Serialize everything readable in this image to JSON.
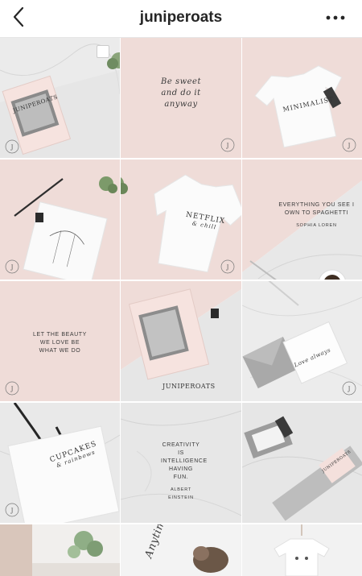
{
  "header": {
    "back_label": "Back",
    "title": "juniperoats",
    "more_label": "More options"
  },
  "posts": [
    {
      "brand": "JUNIPEROATS"
    },
    {
      "quote": "Be sweet and do it anyway"
    },
    {
      "shirt": "MINIMALIST"
    },
    {
      "shirt_line1": "NETFLIX",
      "shirt_line2": "& chill"
    },
    {
      "quote": "EVERYTHING YOU SEE I OWN TO SPAGHETTI",
      "author": "SOPHIA LOREN"
    },
    {
      "quote": "LET THE BEAUTY WE LOVE BE WHAT WE DO"
    },
    {
      "brand": "JUNIPEROATS"
    },
    {
      "card": "Love always"
    },
    {
      "tote_line1": "CUPCAKES",
      "tote_line2": "& rainbows"
    },
    {
      "quote": "CREATIVITY IS INTELLIGENCE HAVING FUN.",
      "author": "ALBERT EINSTEIN"
    },
    {
      "bottle": "JUNIPEROATS"
    },
    {},
    {
      "script": "Anytime"
    },
    {}
  ],
  "logo_mark": "JO",
  "colors": {
    "pink": "#efdcd8",
    "marble": "#e9e9e9",
    "text": "#262626"
  }
}
